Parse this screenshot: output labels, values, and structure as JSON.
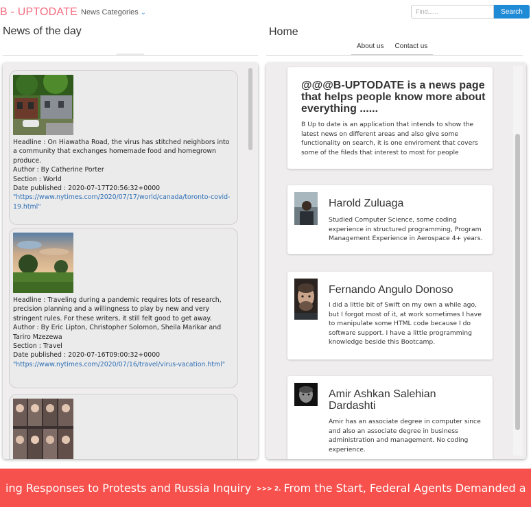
{
  "brand": "B - UPTODATE",
  "nav": {
    "categories_label": "News Categories",
    "search_placeholder": "Find......",
    "search_button": "Search"
  },
  "news": {
    "title": "News of the day",
    "articles": [
      {
        "headline": "Headline : On Hiawatha Road, the virus has stitched neighbors into a community that exchanges homemade food and homegrown produce.",
        "author": "Author : By Catherine Porter",
        "section": "Section : World",
        "date": "Date published : 2020-07-17T20:56:32+0000",
        "link": "\"https://www.nytimes.com/2020/07/17/world/canada/toronto-covid-19.html\""
      },
      {
        "headline": "Headline : Traveling during a pandemic requires lots of research, precision planning and a willingness to play by new and very stringent rules. For these writers, it still felt good to get away.",
        "author": "Author : By Eric Lipton, Christopher Solomon, Sheila Marikar and Tariro Mzezewa",
        "section": "Section : Travel",
        "date": "Date published : 2020-07-16T09:00:32+0000",
        "link": "\"https://www.nytimes.com/2020/07/16/travel/virus-vacation.html\""
      }
    ]
  },
  "home": {
    "title": "Home",
    "links": [
      "About us",
      "Contact us"
    ],
    "about_heading": "@@@B-UPTODATE is a news page that helps people know more about everything ......",
    "about_body": "B Up to date is an application that intends to show the latest news on different areas and also give some functionality on search, it is one enviroment that covers some of the fileds that interest to most for people",
    "people": [
      {
        "name": "Harold Zuluaga",
        "bio": "Studied Computer Science, some coding experience in structured programming, Program Management Experience in Aerospace 4+ years."
      },
      {
        "name": "Fernando Angulo Donoso",
        "bio": "I did a little bit of Swift on my own a while ago, but I forgot most of it, at work sometimes I have to manipulate some HTML code because I do software support. I have a little programming knowledge beside this Bootcamp."
      },
      {
        "name": "Amir Ashkan Salehian Dardashti",
        "bio": "Amir has an associate degree in computer since and also an associate degree in business administration and management. No coding experience."
      }
    ]
  },
  "ticker": {
    "text1": "ing Responses to Protests and Russia Inquiry",
    "separator": ">>> 2.",
    "text2": "From the Start, Federal Agents Demanded a"
  },
  "colors": {
    "brand": "#f36b7f",
    "accent": "#1f8ad6",
    "ticker_bg": "#f7514e",
    "link": "#2d6fb6"
  }
}
